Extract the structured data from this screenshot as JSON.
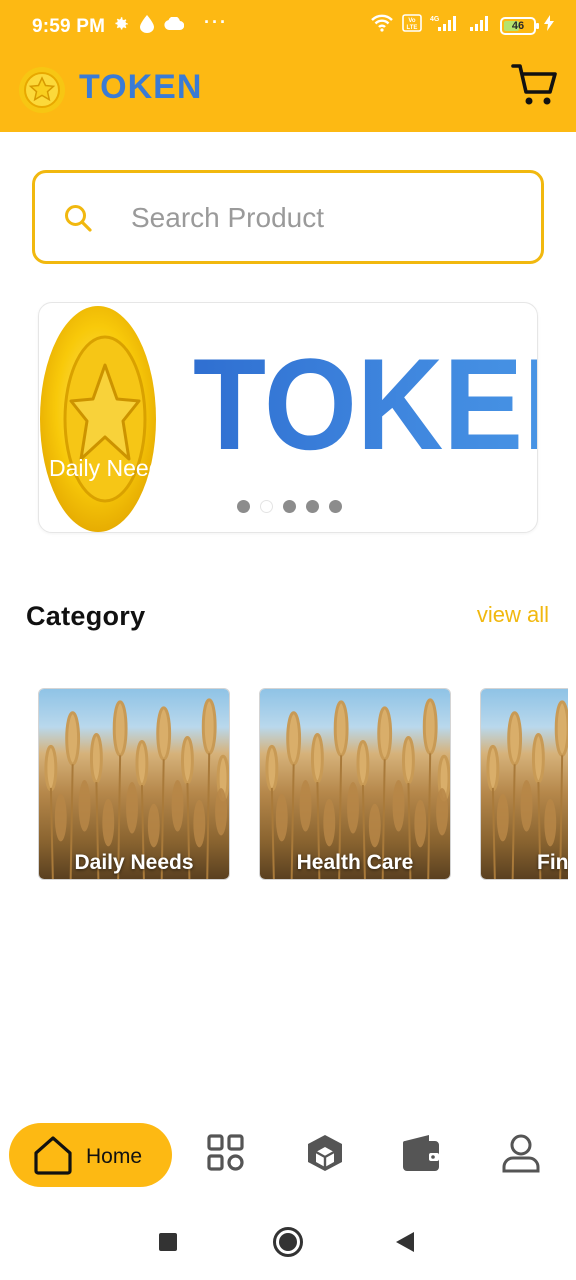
{
  "status_bar": {
    "time": "9:59 PM",
    "dots": "···",
    "battery_level": "46",
    "icons": [
      "settings-gear-icon",
      "water-drop-icon",
      "cloud-icon",
      "wifi-icon",
      "volte-icon",
      "signal-4g-icon",
      "signal-icon",
      "battery-icon",
      "charging-bolt-icon"
    ]
  },
  "header": {
    "logo_text": "TOKEN",
    "cart_icon": "shopping-cart-icon"
  },
  "search": {
    "placeholder": "Search Product",
    "value": ""
  },
  "banner": {
    "caption": "Daily Needs",
    "logo_text": "TOKEN",
    "dots_count": 5,
    "active_dot": 2
  },
  "category": {
    "title": "Category",
    "view_all_label": "view all",
    "items": [
      {
        "label": "Daily Needs"
      },
      {
        "label": "Health Care"
      },
      {
        "label": "Fin"
      }
    ]
  },
  "bottom_nav": {
    "home_label": "Home",
    "items": [
      "home-icon",
      "grid-icon",
      "box-icon",
      "wallet-icon",
      "profile-icon"
    ]
  },
  "colors": {
    "brand_yellow": "#FDB913",
    "search_border": "#F1B80F",
    "logo_blue": "#3A7BD5"
  }
}
